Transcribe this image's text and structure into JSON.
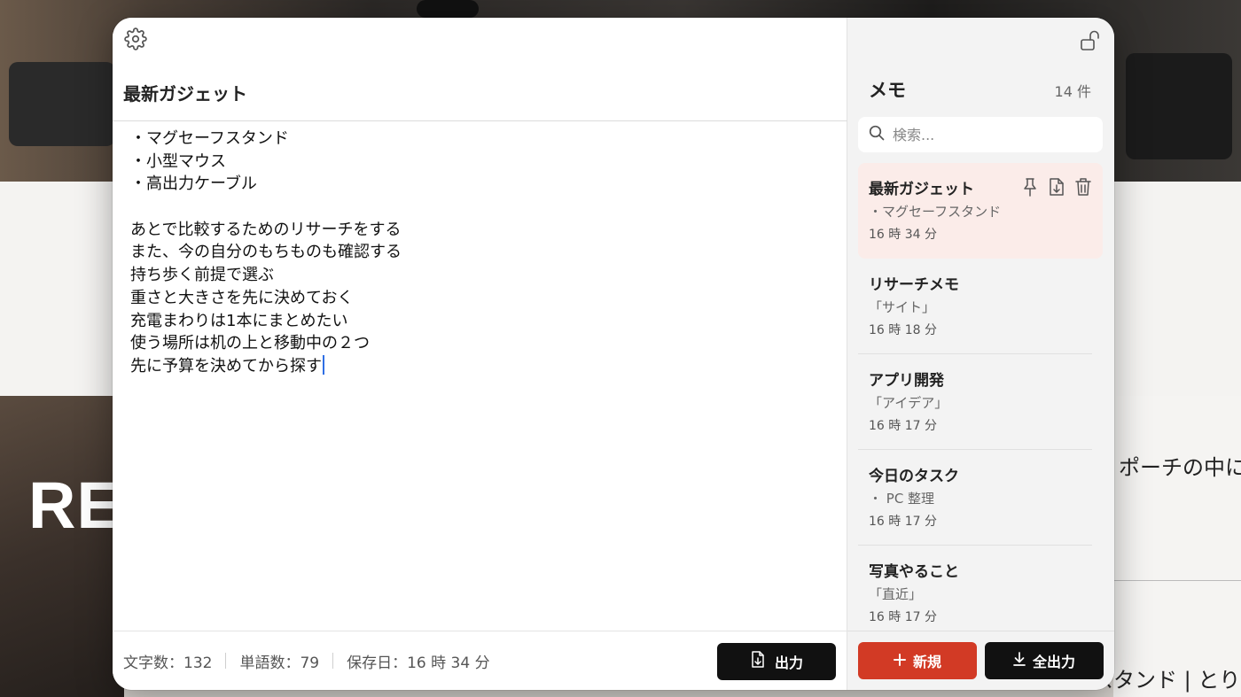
{
  "background": {
    "hero_text": "RE",
    "side_text": "ポーチの中に",
    "side_text_bottom": "スタンド | とり"
  },
  "editor": {
    "title": "最新ガジェット",
    "body_lines": [
      "・マグセーフスタンド",
      "・小型マウス",
      "・高出力ケーブル",
      "",
      "あとで比較するためのリサーチをする",
      "また、今の自分のもちものも確認する",
      "持ち歩く前提で選ぶ",
      "重さと大きさを先に決めておく",
      "充電まわりは1本にまとめたい",
      "使う場所は机の上と移動中の２つ",
      "先に予算を決めてから探す"
    ],
    "stats": {
      "chars": "文字数：132",
      "words": "単語数：79",
      "saved": "保存日：16 時 34 分"
    },
    "export_label": "出力"
  },
  "sidebar": {
    "heading": "メモ",
    "count": "14 件",
    "search_placeholder": "検索...",
    "notes": [
      {
        "title": "最新ガジェット",
        "preview": "・マグセーフスタンド",
        "time": "16 時 34 分",
        "active": true
      },
      {
        "title": "リサーチメモ",
        "preview": "「サイト」",
        "time": "16 時 18 分",
        "active": false
      },
      {
        "title": "アプリ開発",
        "preview": "「アイデア」",
        "time": "16 時 17 分",
        "active": false
      },
      {
        "title": "今日のタスク",
        "preview": "・ PC 整理",
        "time": "16 時 17 分",
        "active": false
      },
      {
        "title": "写真やること",
        "preview": "「直近」",
        "time": "16 時 17 分",
        "active": false
      }
    ],
    "new_label": "新規",
    "export_all_label": "全出力"
  },
  "icons": {
    "settings": "gear-icon",
    "lock": "unlock-icon",
    "search": "search-icon",
    "pin": "pin-icon",
    "download": "file-download-icon",
    "trash": "trash-icon",
    "plus": "plus-icon",
    "download_all": "download-icon"
  },
  "colors": {
    "accent_red": "#d23a25",
    "button_dark": "#111111",
    "active_note_bg": "#fbece9",
    "caret": "#2f6fe4"
  }
}
